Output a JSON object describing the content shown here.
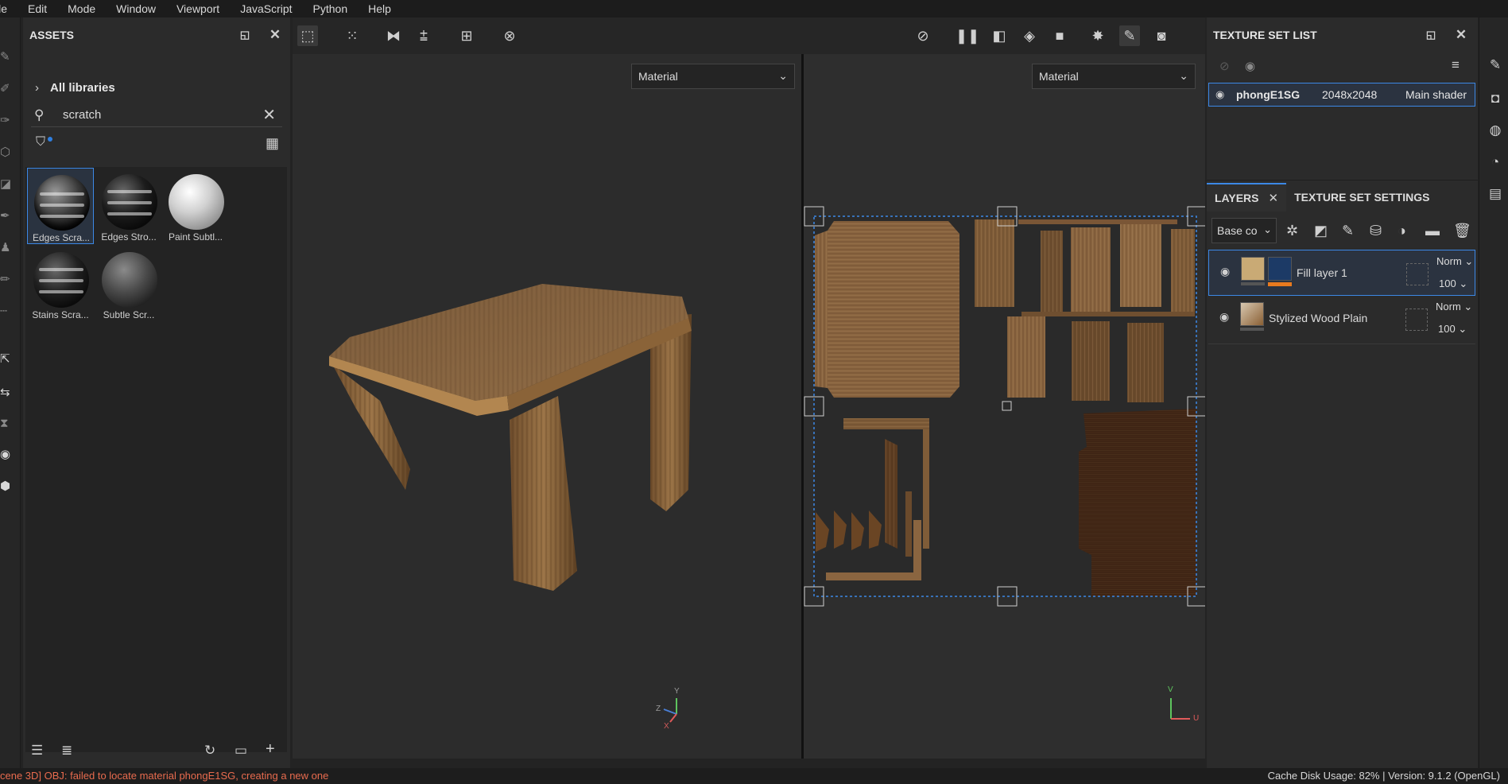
{
  "menu": [
    "ile",
    "Edit",
    "Mode",
    "Window",
    "Viewport",
    "JavaScript",
    "Python",
    "Help"
  ],
  "assets": {
    "title": "ASSETS",
    "library": "All libraries",
    "search": {
      "value": "scratch",
      "placeholder": ""
    },
    "items": [
      {
        "label": "Edges Scra...",
        "selected": true
      },
      {
        "label": "Edges Stro...",
        "selected": false
      },
      {
        "label": "Paint Subtl...",
        "selected": false
      },
      {
        "label": "Stains Scra...",
        "selected": false
      },
      {
        "label": "Subtle Scr...",
        "selected": false
      }
    ]
  },
  "viewports": {
    "left": {
      "mode": "Material",
      "gizmo": {
        "x": "X",
        "y": "Y",
        "z": "Z"
      }
    },
    "right": {
      "mode": "Material",
      "gizmo": {
        "u": "U",
        "v": "V"
      }
    }
  },
  "texture_set_list": {
    "title": "TEXTURE SET LIST",
    "rows": [
      {
        "name": "phongE1SG",
        "resolution": "2048x2048",
        "shader": "Main shader"
      }
    ]
  },
  "tabs": {
    "layers": "LAYERS",
    "settings": "TEXTURE SET SETTINGS"
  },
  "layers": {
    "channel": "Base co",
    "items": [
      {
        "name": "Fill layer 1",
        "blend": "Norm",
        "opacity": "100",
        "selected": true
      },
      {
        "name": "Stylized Wood Plain",
        "blend": "Norm",
        "opacity": "100",
        "selected": false
      }
    ]
  },
  "status": {
    "error": "cene 3D] OBJ: failed to locate material phongE1SG, creating a new one",
    "info": "Cache Disk Usage:  82% | Version: 9.1.2 (OpenGL)"
  },
  "colors": {
    "accent": "#3c88e6",
    "error": "#e86b4e",
    "wood": "#8a6035",
    "dark_wood": "#3a2213"
  }
}
